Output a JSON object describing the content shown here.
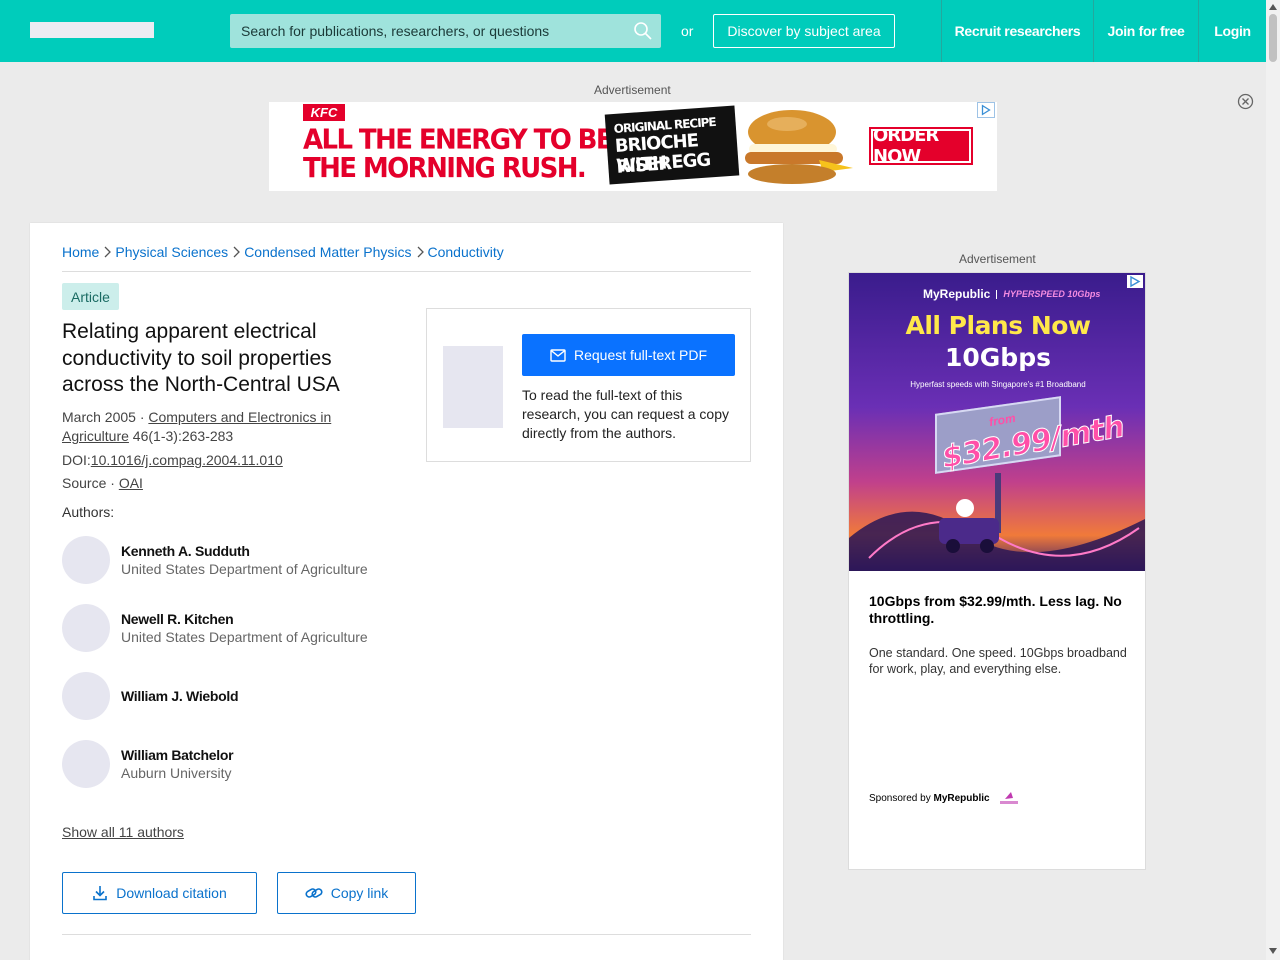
{
  "header": {
    "search_placeholder": "Search for publications, researchers, or questions",
    "or_text": "or",
    "discover_label": "Discover by subject area",
    "nav": [
      "Recruit researchers",
      "Join for free",
      "Login"
    ]
  },
  "top_ad": {
    "label": "Advertisement",
    "brand": "KFC",
    "headline_line1": "ALL THE ENERGY TO BEAT",
    "headline_line2": "THE MORNING RUSH.",
    "sign_line1": "ORIGINAL RECIPE",
    "sign_line2": "BRIOCHE RISER",
    "sign_line3": "WITH EGG",
    "cta": "ORDER NOW"
  },
  "article": {
    "breadcrumb": [
      "Home",
      "Physical Sciences",
      "Condensed Matter Physics",
      "Conductivity"
    ],
    "type_badge": "Article",
    "title": "Relating apparent electrical conductivity to soil properties across the North-Central USA",
    "date": "March 2005 · ",
    "journal": "Computers and Electronics in Agriculture",
    "volume": " 46(1-3):263-283",
    "doi_label": "DOI:",
    "doi": "10.1016/j.compag.2004.11.010",
    "source_label": "Source · ",
    "source": "OAI",
    "authors_label": "Authors:",
    "authors": [
      {
        "name": "Kenneth A. Sudduth",
        "affiliation": "United States Department of Agriculture"
      },
      {
        "name": "Newell R. Kitchen",
        "affiliation": "United States Department of Agriculture"
      },
      {
        "name": "William J. Wiebold",
        "affiliation": ""
      },
      {
        "name": "William Batchelor",
        "affiliation": "Auburn University"
      }
    ],
    "show_all": "Show all 11 authors",
    "download_citation": "Download citation",
    "copy_link": "Copy link"
  },
  "request": {
    "button": "Request full-text PDF",
    "text": "To read the full-text of this research, you can request a copy directly from the authors."
  },
  "side_ad": {
    "label": "Advertisement",
    "brand": "MyRepublic",
    "speed_badge": "HYPERSPEED 10Gbps",
    "headline": "All Plans Now",
    "headline2": "10Gbps",
    "tagline": "Hyperfast speeds with Singapore's #1 Broadband",
    "price_from": "from",
    "price": "$32.99/mth",
    "title": "10Gbps from $32.99/mth. Less lag. No throttling.",
    "description": "One standard. One speed. 10Gbps broadband for work, play, and everything else.",
    "sponsored_prefix": "Sponsored by ",
    "sponsor": "MyRepublic"
  },
  "colors": {
    "header_bg": "#00ccbb",
    "link_blue": "#0a72cc",
    "primary_button": "#0a72ff",
    "kfc_red": "#e4002b"
  }
}
